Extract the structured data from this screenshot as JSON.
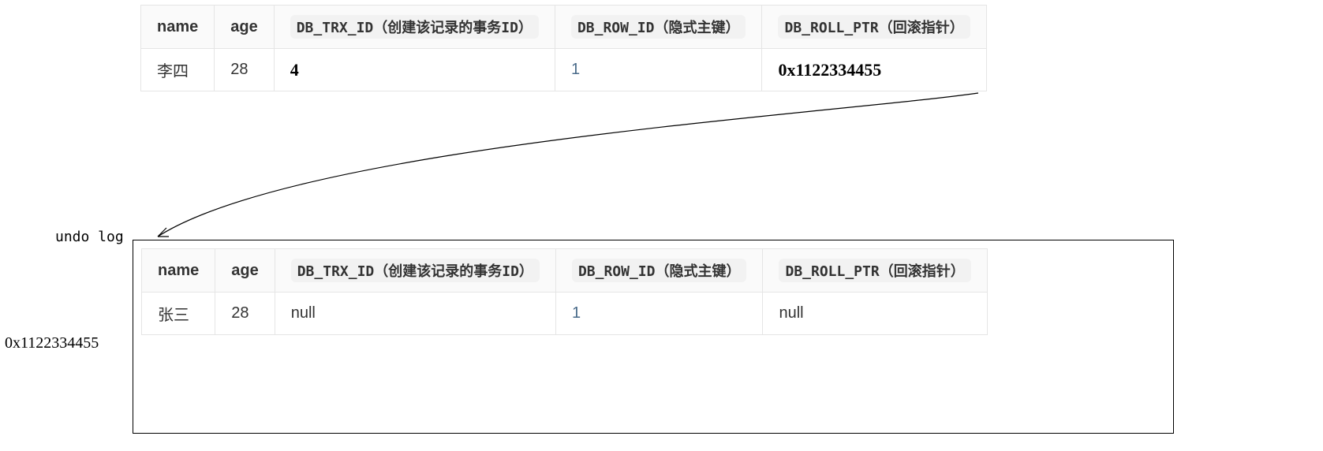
{
  "labels": {
    "undo_log": "undo log",
    "undo_addr": "0x1122334455"
  },
  "columns": {
    "name": "name",
    "age": "age",
    "trx": "DB_TRX_ID（创建该记录的事务ID）",
    "row": "DB_ROW_ID（隐式主键）",
    "ptr": "DB_ROLL_PTR（回滚指针）"
  },
  "current_row": {
    "name": "李四",
    "age": "28",
    "trx": "4",
    "row": "1",
    "ptr": "0x1122334455"
  },
  "undo_row": {
    "name": "张三",
    "age": "28",
    "trx": "null",
    "row": "1",
    "ptr": "null"
  }
}
